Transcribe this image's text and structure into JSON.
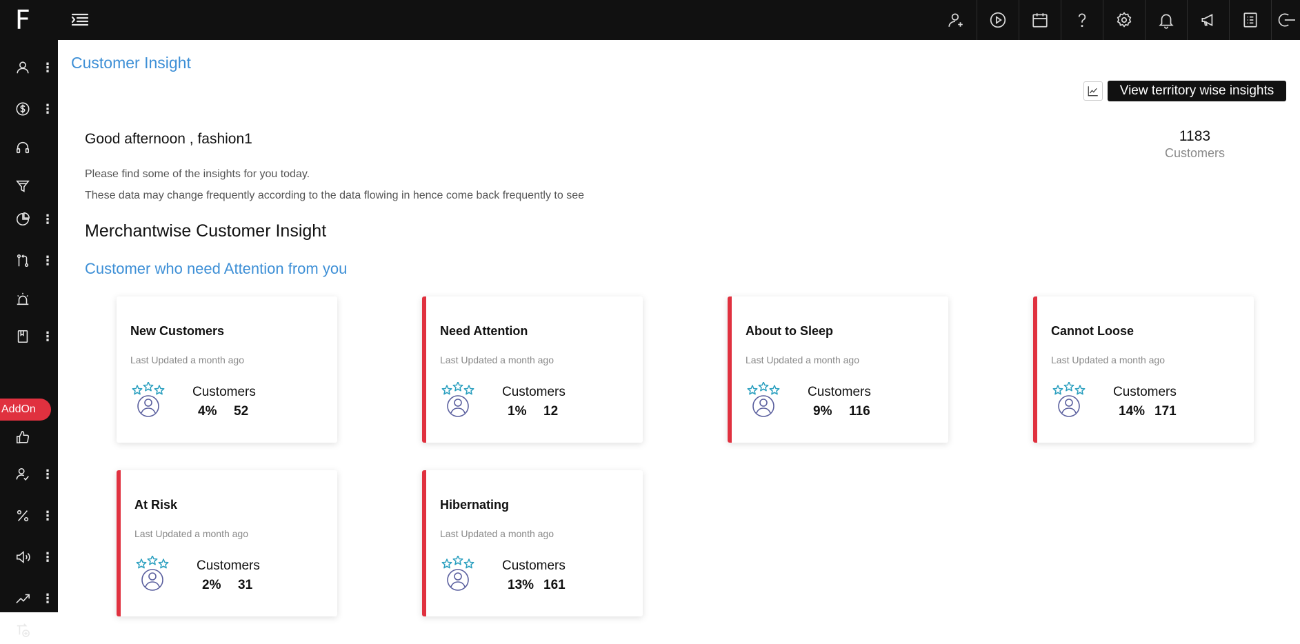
{
  "topbar": {
    "logo": "F",
    "icons": [
      "add-user-icon",
      "play-icon",
      "calendar-icon",
      "help-icon",
      "settings-icon",
      "notification-icon",
      "megaphone-icon",
      "list-icon",
      "logout-icon"
    ]
  },
  "sidebar": {
    "items": [
      "user-icon",
      "dollar-icon",
      "headset-icon",
      "funnel-icon",
      "pie-chart-icon",
      "git-compare-icon",
      "alarm-icon",
      "book-icon",
      "thumbs-up-icon",
      "user-check-icon",
      "percent-icon",
      "speaker-icon",
      "trending-up-icon",
      "route-add-icon"
    ],
    "addon_label": "AddOn"
  },
  "header": {
    "title": "Customer Insight",
    "territory_button": "View territory wise insights"
  },
  "greeting": {
    "text": "Good afternoon , fashion1",
    "line1": "Please find some of the insights for you today.",
    "line2": "These data may change frequently according to the data flowing in hence come back frequently to see"
  },
  "summary": {
    "total_customers": "1183",
    "total_label": "Customers"
  },
  "sections": {
    "merchant_heading": "Merchantwise Customer Insight",
    "attention_heading": "Customer who need Attention from you"
  },
  "cards": [
    {
      "title": "New Customers",
      "updated": "Last Updated a month ago",
      "label": "Customers",
      "percent": "4%",
      "count": "52"
    },
    {
      "title": "Need Attention",
      "updated": "Last Updated a month ago",
      "label": "Customers",
      "percent": "1%",
      "count": "12"
    },
    {
      "title": "About to Sleep",
      "updated": "Last Updated a month ago",
      "label": "Customers",
      "percent": "9%",
      "count": "116"
    },
    {
      "title": "Cannot Loose",
      "updated": "Last Updated a month ago",
      "label": "Customers",
      "percent": "14%",
      "count": "171"
    },
    {
      "title": "At Risk",
      "updated": "Last Updated a month ago",
      "label": "Customers",
      "percent": "2%",
      "count": "31"
    },
    {
      "title": "Hibernating",
      "updated": "Last Updated a month ago",
      "label": "Customers",
      "percent": "13%",
      "count": "161"
    }
  ],
  "colors": {
    "brand_blue": "#3d8fd6",
    "accent_red": "#e0313f",
    "dark": "#111111",
    "star_teal": "#2a9fbf",
    "avatar_purple": "#5a5f9e"
  }
}
